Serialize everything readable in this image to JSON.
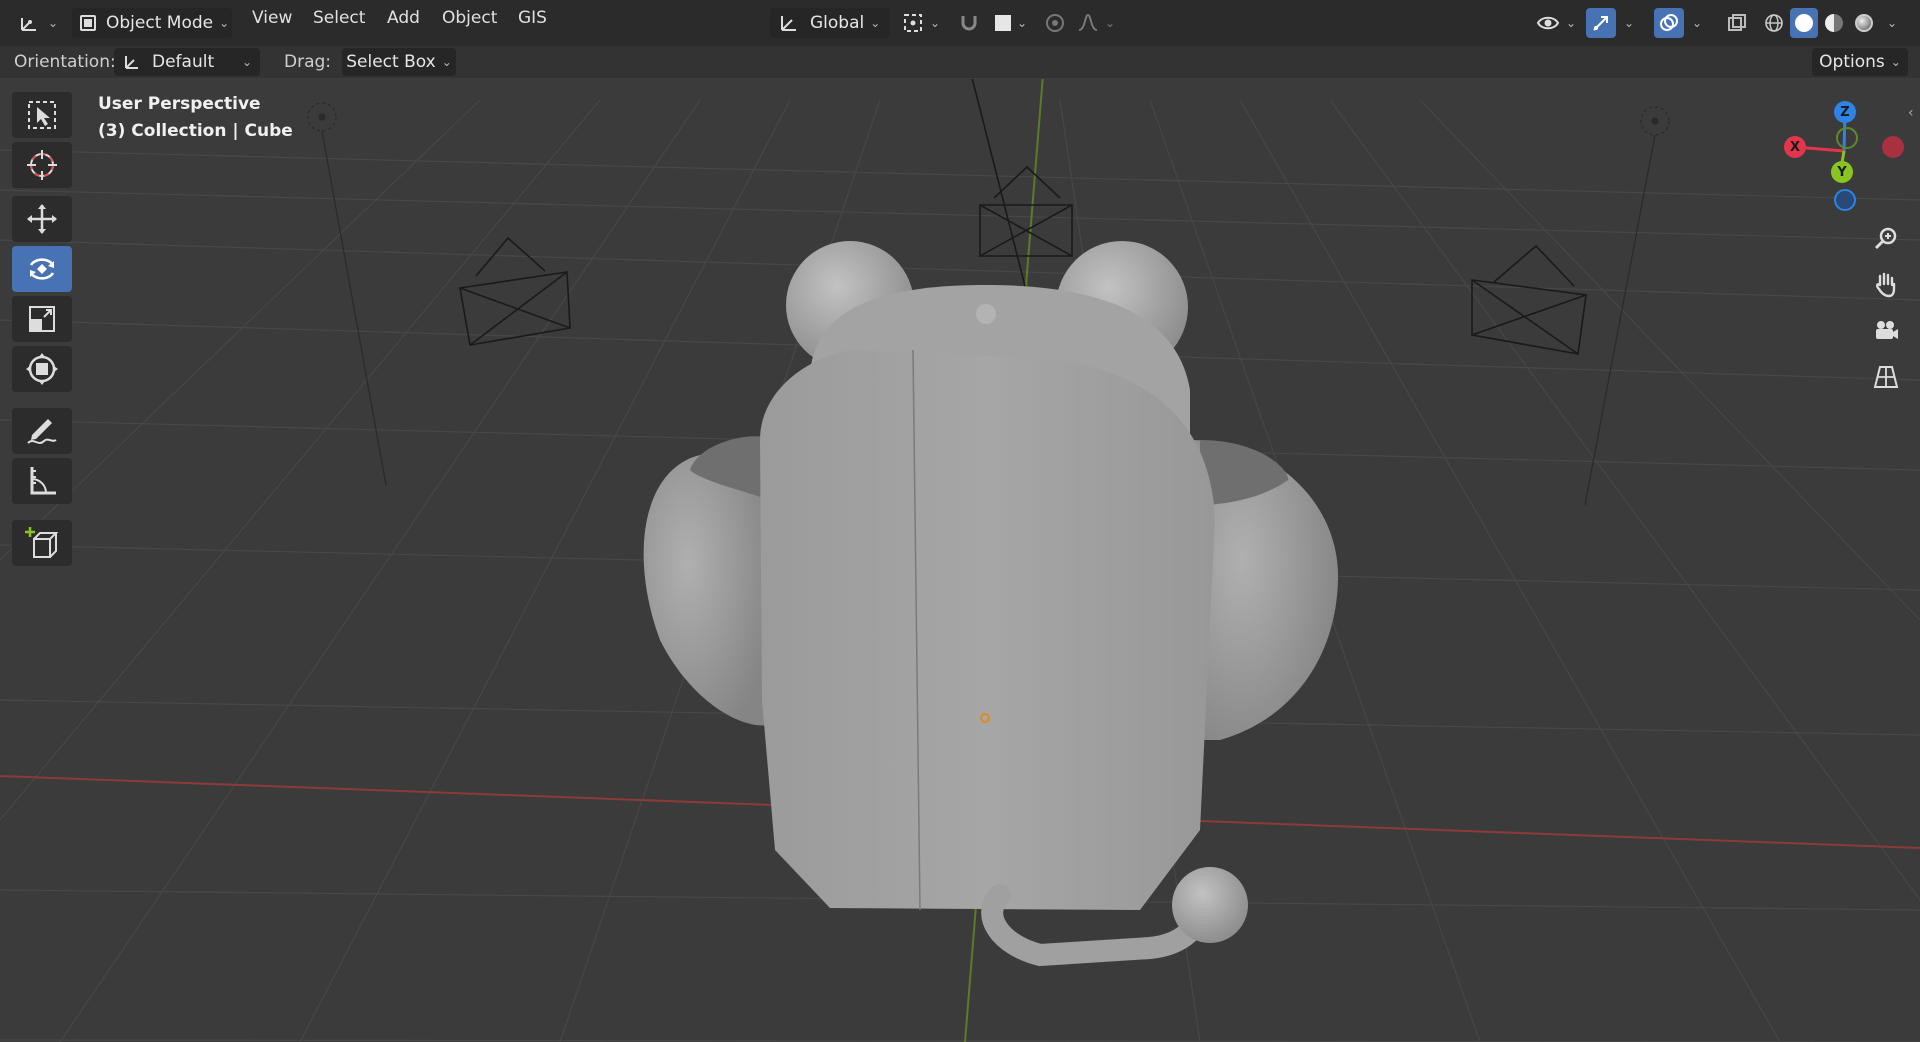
{
  "header": {
    "mode": "Object Mode",
    "menus": [
      "View",
      "Select",
      "Add",
      "Object",
      "GIS"
    ],
    "transform_orientation": "Global",
    "options_label": "Options"
  },
  "tool_settings": {
    "orientation_label": "Orientation:",
    "orientation_value": "Default",
    "drag_label": "Drag:",
    "drag_value": "Select Box"
  },
  "viewport": {
    "view_name": "User Perspective",
    "context": "(3) Collection | Cube"
  },
  "gizmo": {
    "x_label": "X",
    "y_label": "Y",
    "z_label": "Z",
    "colors": {
      "x": "#e3354b",
      "y": "#8ac420",
      "z": "#2f83e4"
    }
  },
  "toolbar": {
    "tools": [
      "select-box",
      "cursor",
      "move",
      "rotate",
      "scale",
      "transform",
      "annotate",
      "measure",
      "add-cube"
    ],
    "active": "rotate"
  },
  "theme": {
    "accent": "#4772b3",
    "header_bg": "#2b2b2b",
    "viewport_bg": "#3b3b3b"
  }
}
